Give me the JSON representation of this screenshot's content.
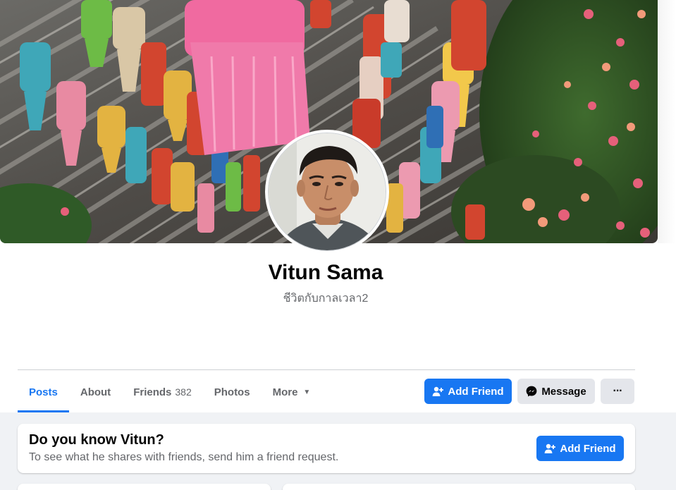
{
  "profile": {
    "name": "Vitun Sama",
    "bio": "ชีวิตกับกาลเวลา2"
  },
  "tabs": [
    {
      "label": "Posts",
      "active": true
    },
    {
      "label": "About"
    },
    {
      "label": "Friends",
      "count": "382"
    },
    {
      "label": "Photos"
    },
    {
      "label": "More",
      "icon": "caret-down-icon"
    }
  ],
  "actions": {
    "add_friend": "Add Friend",
    "message": "Message",
    "more": "···"
  },
  "prompt_card": {
    "title": "Do you know Vitun?",
    "subtitle": "To see what he shares with friends, send him a friend request.",
    "button": "Add Friend"
  },
  "colors": {
    "accent": "#1877f2",
    "secondary_button": "#e4e6eb",
    "muted_text": "#65676b",
    "page_background": "#f0f2f5"
  }
}
